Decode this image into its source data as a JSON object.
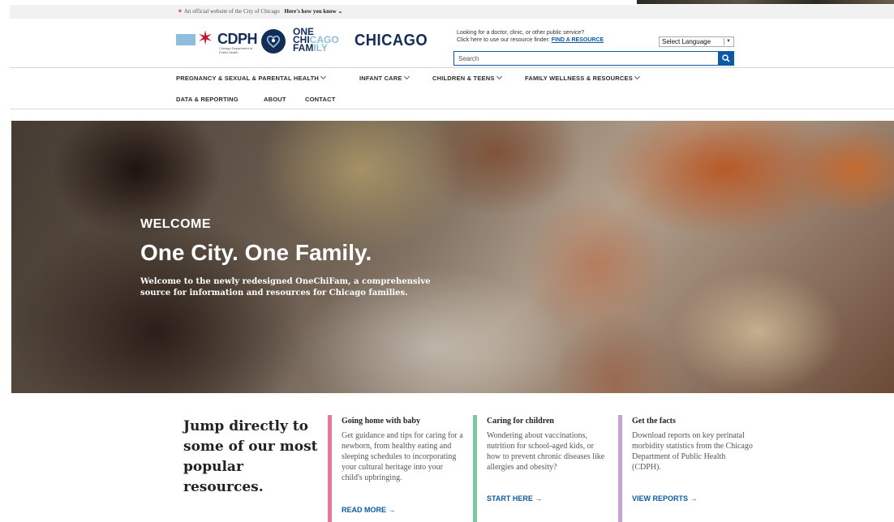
{
  "official_banner": {
    "text": "An official website of the City of Chicago",
    "link": "Here's how you know"
  },
  "logos": {
    "cdph_wordmark": "CDPH",
    "cdph_subtitle": "Chicago Department of Public Health",
    "ocf_line1": "ONE",
    "ocf_line2a": "CHI",
    "ocf_line2b": "CAGO",
    "ocf_line3a": "FAM",
    "ocf_line3b": "ILY",
    "chicago_wordmark": "CHICAGO"
  },
  "resource_finder": {
    "line1": "Looking for a doctor, clinic, or other public service?",
    "line2": "Click here to use our resource finder:",
    "link": "FIND A RESOURCE",
    "language_select": "Select Language"
  },
  "search": {
    "placeholder": "Search"
  },
  "nav": {
    "items": [
      "PREGNANCY & SEXUAL & PARENTAL HEALTH",
      "INFANT CARE",
      "CHILDREN & TEENS",
      "FAMILY WELLNESS & RESOURCES",
      "DATA & REPORTING",
      "ABOUT",
      "CONTACT"
    ]
  },
  "hero": {
    "eyebrow": "WELCOME",
    "title": "One City. One Family.",
    "description": "Welcome to the newly redesigned OneChiFam, a comprehensive source for information and resources for Chicago families."
  },
  "resources": {
    "heading": "Jump directly to some of our most popular resources.",
    "cards": [
      {
        "title": "Going home with baby",
        "body": "Get guidance and tips for caring for a newborn, from healthy eating and sleeping schedules to incorporating your cultural heritage into your child's upbringing.",
        "link": "READ MORE →",
        "accent": "#e8789a"
      },
      {
        "title": "Caring for children",
        "body": "Wondering about vaccinations, nutrition for school-aged kids, or how to prevent chronic diseases like allergies and obesity?",
        "link": "START HERE →",
        "accent": "#7ec8a8"
      },
      {
        "title": "Get the facts",
        "body": "Download reports on key perinatal morbidity statistics from the Chicago Department of Public Health (CDPH).",
        "link": "VIEW REPORTS →",
        "accent": "#c9a0d6"
      }
    ]
  },
  "colors": {
    "primary_blue": "#0c5aa6",
    "navy": "#132d57",
    "chicago_red": "#c8102e",
    "light_blue": "#8fbde0"
  }
}
